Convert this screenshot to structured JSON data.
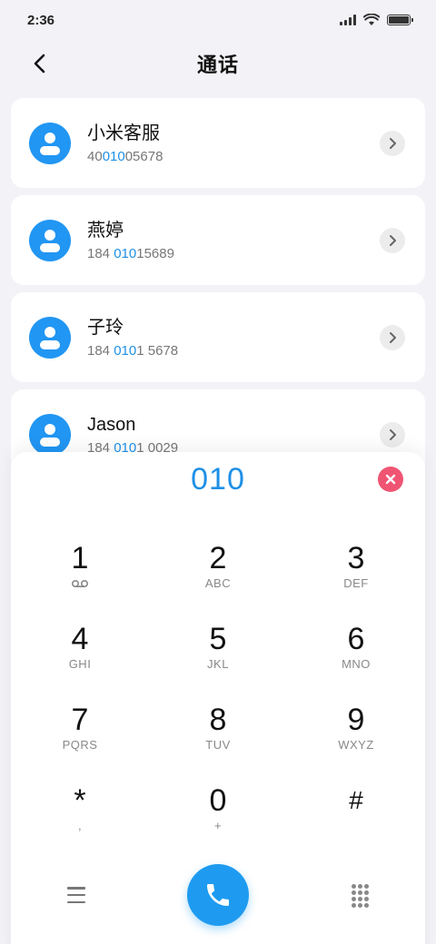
{
  "status_bar": {
    "time": "2:36",
    "signal_icon": "signal-icon",
    "wifi_icon": "wifi-icon",
    "battery_icon": "battery-icon"
  },
  "header": {
    "title": "通话",
    "back_icon": "chevron-left-icon"
  },
  "contacts": [
    {
      "name": "小米客服",
      "number_pre": "40",
      "number_match": "010",
      "number_post": "05678"
    },
    {
      "name": "燕婷",
      "number_pre": "184 ",
      "number_match": "010",
      "number_post": "15689"
    },
    {
      "name": "子玲",
      "number_pre": "184 ",
      "number_match": "010",
      "number_post": "1 5678"
    },
    {
      "name": "Jason",
      "number_pre": "184 ",
      "number_match": "010",
      "number_post": "1 0029"
    }
  ],
  "dialpad": {
    "input_value": "010",
    "clear_icon": "close-circle-icon",
    "keys": [
      {
        "digit": "1",
        "letters": ""
      },
      {
        "digit": "2",
        "letters": "ABC"
      },
      {
        "digit": "3",
        "letters": "DEF"
      },
      {
        "digit": "4",
        "letters": "GHI"
      },
      {
        "digit": "5",
        "letters": "JKL"
      },
      {
        "digit": "6",
        "letters": "MNO"
      },
      {
        "digit": "7",
        "letters": "PQRS"
      },
      {
        "digit": "8",
        "letters": "TUV"
      },
      {
        "digit": "9",
        "letters": "WXYZ"
      },
      {
        "digit": "*",
        "letters": ","
      },
      {
        "digit": "0",
        "letters": "+"
      },
      {
        "digit": "#",
        "letters": ""
      }
    ],
    "menu_icon": "menu-icon",
    "call_icon": "phone-icon",
    "keypad_icon": "keypad-icon"
  },
  "colors": {
    "accent": "#1e90e6",
    "call_button": "#1e9bf0",
    "clear_button": "#ef5572",
    "avatar": "#2196f3"
  }
}
